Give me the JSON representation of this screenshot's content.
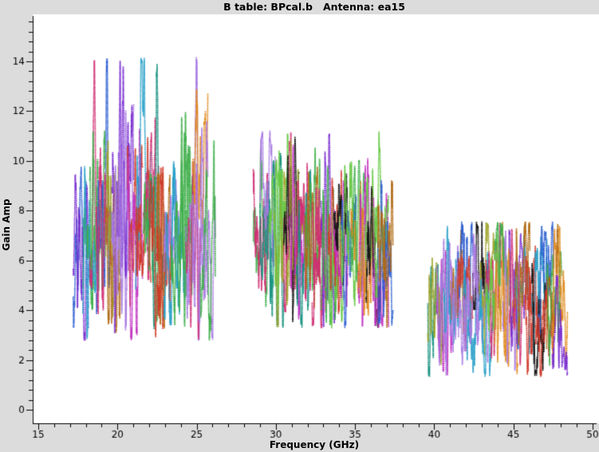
{
  "window": {
    "title": "B table: BPcal.b   Antenna: ea15"
  },
  "chart_data": {
    "type": "scatter",
    "title": "B table: BPcal.b   Antenna: ea15",
    "xlabel": "Frequency (GHz)",
    "ylabel": "Gain Amp",
    "xlim": [
      15,
      50
    ],
    "ylim": [
      0,
      15.8
    ],
    "x_major_ticks": [
      15,
      20,
      25,
      30,
      35,
      40,
      45,
      50
    ],
    "x_minor_step": 1,
    "y_major_ticks": [
      0,
      2,
      4,
      6,
      8,
      10,
      12,
      14
    ],
    "y_minor_step": 0.4,
    "grid": false,
    "legend": null,
    "background": "#dcdcdc",
    "plot_background": "#ffffff",
    "axis_color": "#000000",
    "marker": "dotted-line",
    "palette": [
      "#2e5fd0",
      "#3fae4a",
      "#d02f74",
      "#e08a1e",
      "#7a2fd0",
      "#141414",
      "#16917f",
      "#a97ae0",
      "#b06a14",
      "#67c845",
      "#2aa0c8",
      "#c02fc0",
      "#9da32a",
      "#cf3a2a"
    ],
    "clusters": [
      {
        "f_start": 17.55,
        "f_end": 26.0,
        "n_centers": 18,
        "trace_width": 0.95,
        "channels": 56,
        "amp_min": 2.8,
        "amp_max": 14.15,
        "jitter": 1.5,
        "wiggle": 2.2,
        "noise": 0.55,
        "seed": 7,
        "envelope": [
          [
            0,
            4.8
          ],
          [
            0.06,
            6.4
          ],
          [
            0.18,
            7.6
          ],
          [
            0.3,
            8.1
          ],
          [
            0.42,
            8.3
          ],
          [
            0.55,
            7.7
          ],
          [
            0.68,
            7.2
          ],
          [
            0.8,
            7.6
          ],
          [
            0.9,
            8.2
          ],
          [
            0.97,
            6.6
          ],
          [
            1,
            4.8
          ]
        ],
        "spikes": [
          {
            "f": 18.55,
            "amp": 12.0,
            "color": "#d02f74"
          },
          {
            "f": 19.35,
            "amp": 11.8,
            "color": "#2e5fd0"
          },
          {
            "f": 20.15,
            "amp": 12.9,
            "color": "#7a2fd0"
          },
          {
            "f": 21.55,
            "amp": 12.0,
            "color": "#2aa0c8"
          },
          {
            "f": 22.5,
            "amp": 11.3,
            "color": "#16917f"
          },
          {
            "f": 24.3,
            "amp": 11.4,
            "color": "#3fae4a"
          },
          {
            "f": 25.0,
            "amp": 14.15,
            "color": "#a97ae0"
          }
        ]
      },
      {
        "f_start": 28.8,
        "f_end": 37.25,
        "n_centers": 18,
        "trace_width": 0.95,
        "channels": 56,
        "amp_min": 3.3,
        "amp_max": 11.2,
        "jitter": 1.15,
        "wiggle": 1.85,
        "noise": 0.5,
        "seed": 13,
        "envelope": [
          [
            0,
            6.3
          ],
          [
            0.06,
            7.7
          ],
          [
            0.15,
            7.1
          ],
          [
            0.26,
            7.4
          ],
          [
            0.36,
            6.8
          ],
          [
            0.5,
            6.4
          ],
          [
            0.64,
            6.2
          ],
          [
            0.8,
            6.3
          ],
          [
            0.92,
            6.0
          ],
          [
            1,
            5.3
          ]
        ],
        "spikes": [
          {
            "f": 29.05,
            "amp": 11.1,
            "color": "#3fae4a"
          },
          {
            "f": 29.55,
            "amp": 10.5,
            "color": "#16917f"
          },
          {
            "f": 30.9,
            "amp": 10.3,
            "color": "#d02f74"
          },
          {
            "f": 33.35,
            "amp": 9.5,
            "color": "#7a2fd0"
          },
          {
            "f": 35.3,
            "amp": 8.8,
            "color": "#e08a1e"
          }
        ]
      },
      {
        "f_start": 39.85,
        "f_end": 48.2,
        "n_centers": 18,
        "trace_width": 0.95,
        "channels": 56,
        "amp_min": 1.35,
        "amp_max": 7.55,
        "jitter": 0.9,
        "wiggle": 1.45,
        "noise": 0.45,
        "seed": 21,
        "envelope": [
          [
            0,
            3.9
          ],
          [
            0.1,
            4.5
          ],
          [
            0.2,
            4.7
          ],
          [
            0.33,
            4.4
          ],
          [
            0.45,
            4.7
          ],
          [
            0.55,
            4.9
          ],
          [
            0.66,
            4.4
          ],
          [
            0.78,
            4.3
          ],
          [
            0.88,
            4.6
          ],
          [
            0.95,
            3.5
          ],
          [
            1,
            1.8
          ]
        ],
        "spikes": [
          {
            "f": 41.3,
            "amp": 6.9,
            "color": "#b06a14"
          },
          {
            "f": 44.35,
            "amp": 7.5,
            "color": "#e08a1e"
          },
          {
            "f": 46.9,
            "amp": 6.7,
            "color": "#2e5fd0"
          }
        ]
      }
    ]
  }
}
